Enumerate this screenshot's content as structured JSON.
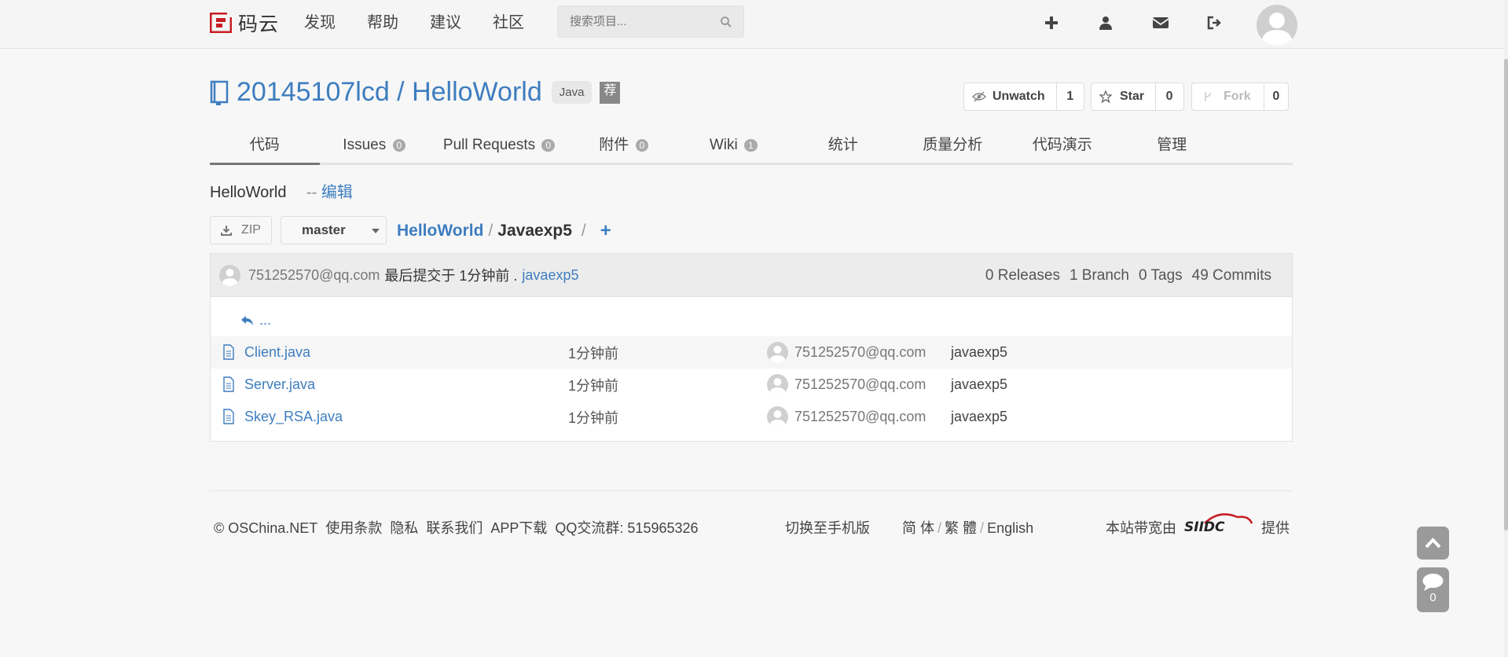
{
  "brand": {
    "name": "码云",
    "accent": "#c71d23"
  },
  "nav": [
    "发现",
    "帮助",
    "建议",
    "社区"
  ],
  "search": {
    "placeholder": "搜索项目..."
  },
  "top_icons": [
    "plus-icon",
    "user-icon",
    "envelope-icon",
    "sign-out-icon"
  ],
  "repo": {
    "owner_name": "20145107lcd / HelloWorld",
    "language": "Java",
    "recommend": "荐",
    "watch": {
      "label": "Unwatch",
      "count": "1"
    },
    "star": {
      "label": "Star",
      "count": "0"
    },
    "fork": {
      "label": "Fork",
      "count": "0"
    }
  },
  "tabs": [
    {
      "label": "代码",
      "count": ""
    },
    {
      "label": "Issues",
      "count": "0"
    },
    {
      "label": "Pull Requests",
      "count": "0"
    },
    {
      "label": "附件",
      "count": "0"
    },
    {
      "label": "Wiki",
      "count": "1"
    },
    {
      "label": "统计",
      "count": ""
    },
    {
      "label": "质量分析",
      "count": ""
    },
    {
      "label": "代码演示",
      "count": ""
    },
    {
      "label": "管理",
      "count": ""
    }
  ],
  "description": {
    "text": "HelloWorld",
    "edit_prefix": "-- ",
    "edit_label": "编辑"
  },
  "toolbar": {
    "zip": "ZIP",
    "branch": "master",
    "path_root": "HelloWorld",
    "path_sep": "/",
    "path_current": "Javaexp5",
    "path_add": "+"
  },
  "commit": {
    "author": "751252570@qq.com",
    "text": "最后提交于 1分钟前 .",
    "message": "javaexp5",
    "releases": "0 Releases",
    "branches": "1 Branch",
    "tags": "0 Tags",
    "commits": "49 Commits"
  },
  "back_label": "...",
  "files": [
    {
      "name": "Client.java",
      "time": "1分钟前",
      "author": "751252570@qq.com",
      "message": "javaexp5"
    },
    {
      "name": "Server.java",
      "time": "1分钟前",
      "author": "751252570@qq.com",
      "message": "javaexp5"
    },
    {
      "name": "Skey_RSA.java",
      "time": "1分钟前",
      "author": "751252570@qq.com",
      "message": "javaexp5"
    }
  ],
  "footer": {
    "copyright": "© OSChina.NET",
    "terms": "使用条款",
    "privacy": "隐私",
    "contact": "联系我们",
    "app": "APP下载",
    "qq": "QQ交流群: 515965326",
    "mobile": "切换至手机版",
    "lang_simplified": "简 体",
    "lang_traditional": "繁 體",
    "lang_english": "English",
    "bandwidth_prefix": "本站带宽由",
    "sponsor_logo": "SIIDC",
    "bandwidth_suffix": "提供"
  },
  "float": {
    "comment_count": "0"
  }
}
